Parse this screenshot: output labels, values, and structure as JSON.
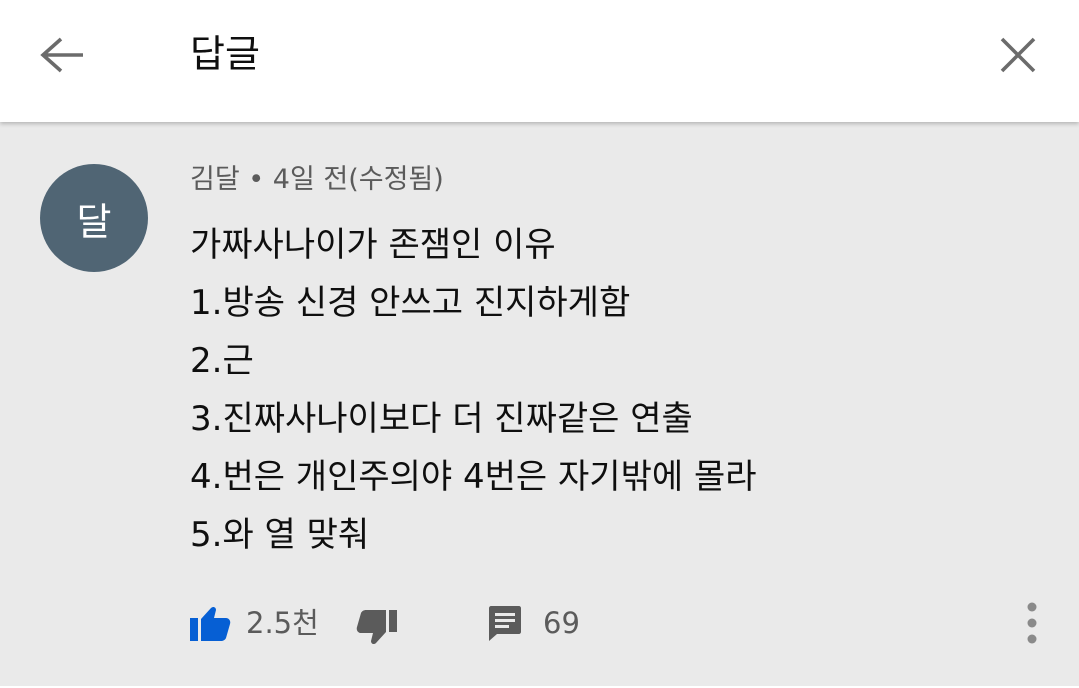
{
  "header": {
    "title": "답글",
    "back_icon": "arrow-left-icon",
    "close_icon": "close-icon"
  },
  "comment": {
    "avatar_letter": "달",
    "avatar_color": "#506574",
    "meta": "김달 • 4일 전(수정됨)",
    "lines": [
      "가짜사나이가 존잼인 이유",
      "1.방송 신경 안쓰고 진지하게함",
      "2.근",
      "3.진짜사나이보다 더 진짜같은 연출",
      "4.번은 개인주의야 4번은 자기밖에 몰라",
      "5.와 열 맞춰"
    ],
    "likes": "2.5천",
    "replies": "69",
    "like_color": "#065fd4"
  }
}
